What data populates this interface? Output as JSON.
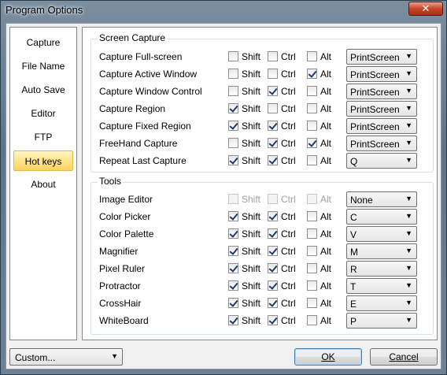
{
  "window": {
    "title": "Program Options",
    "close_glyph": "✕"
  },
  "nav": {
    "items": [
      {
        "label": "Capture",
        "selected": false
      },
      {
        "label": "File Name",
        "selected": false
      },
      {
        "label": "Auto Save",
        "selected": false
      },
      {
        "label": "Editor",
        "selected": false
      },
      {
        "label": "FTP",
        "selected": false
      },
      {
        "label": "Hot keys",
        "selected": true
      },
      {
        "label": "About",
        "selected": false
      }
    ]
  },
  "modifier_labels": {
    "shift": "Shift",
    "ctrl": "Ctrl",
    "alt": "Alt"
  },
  "dropdown_arrow": "▼",
  "screen_capture": {
    "title": "Screen Capture",
    "rows": [
      {
        "label": "Capture Full-screen",
        "shift": false,
        "ctrl": false,
        "alt": false,
        "key": "PrintScreen",
        "disabled": false
      },
      {
        "label": "Capture Active Window",
        "shift": false,
        "ctrl": false,
        "alt": true,
        "key": "PrintScreen",
        "disabled": false
      },
      {
        "label": "Capture Window Control",
        "shift": false,
        "ctrl": true,
        "alt": false,
        "key": "PrintScreen",
        "disabled": false
      },
      {
        "label": "Capture Region",
        "shift": true,
        "ctrl": false,
        "alt": false,
        "key": "PrintScreen",
        "disabled": false
      },
      {
        "label": "Capture Fixed Region",
        "shift": true,
        "ctrl": true,
        "alt": false,
        "key": "PrintScreen",
        "disabled": false
      },
      {
        "label": "FreeHand Capture",
        "shift": false,
        "ctrl": true,
        "alt": true,
        "key": "PrintScreen",
        "disabled": false
      },
      {
        "label": "Repeat Last Capture",
        "shift": true,
        "ctrl": true,
        "alt": false,
        "key": "Q",
        "disabled": false
      }
    ]
  },
  "tools": {
    "title": "Tools",
    "rows": [
      {
        "label": "Image Editor",
        "shift": false,
        "ctrl": false,
        "alt": false,
        "key": "None",
        "disabled": true
      },
      {
        "label": "Color Picker",
        "shift": true,
        "ctrl": true,
        "alt": false,
        "key": "C",
        "disabled": false
      },
      {
        "label": "Color Palette",
        "shift": true,
        "ctrl": true,
        "alt": false,
        "key": "V",
        "disabled": false
      },
      {
        "label": "Magnifier",
        "shift": true,
        "ctrl": true,
        "alt": false,
        "key": "M",
        "disabled": false
      },
      {
        "label": "Pixel Ruler",
        "shift": true,
        "ctrl": true,
        "alt": false,
        "key": "R",
        "disabled": false
      },
      {
        "label": "Protractor",
        "shift": true,
        "ctrl": true,
        "alt": false,
        "key": "T",
        "disabled": false
      },
      {
        "label": "CrossHair",
        "shift": true,
        "ctrl": true,
        "alt": false,
        "key": "E",
        "disabled": false
      },
      {
        "label": "WhiteBoard",
        "shift": true,
        "ctrl": true,
        "alt": false,
        "key": "P",
        "disabled": false
      }
    ]
  },
  "footer": {
    "preset_value": "Custom...",
    "ok_label": "OK",
    "cancel_label": "Cancel"
  }
}
